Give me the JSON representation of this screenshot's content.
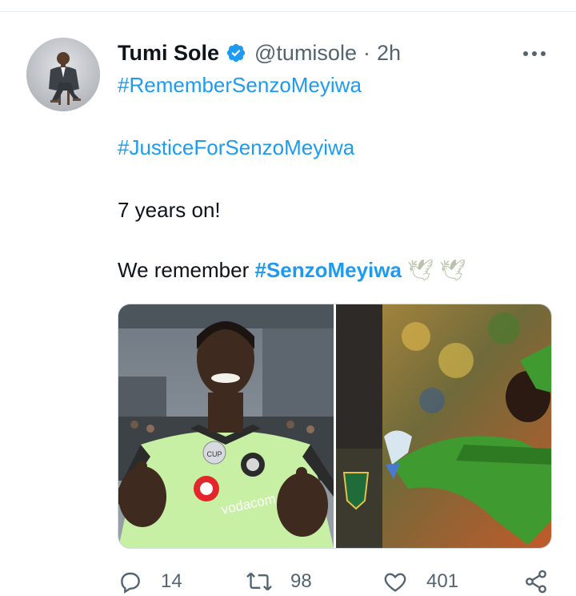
{
  "tweet": {
    "author_name": "Tumi Sole",
    "handle": "@tumisole",
    "separator": "·",
    "time": "2h",
    "lines": {
      "hashtag1": "#RememberSenzoMeyiwa",
      "hashtag2": "#JusticeForSenzoMeyiwa",
      "line3": "7 years on!",
      "line4_prefix": "We remember ",
      "line4_hashtag": "#SenzoMeyiwa",
      "line4_emoji": "🕊 🕊"
    }
  },
  "media": {
    "left_photo": {
      "badge_text": "CUP",
      "sponsor_text": "vodacom"
    }
  },
  "actions": {
    "replies": "14",
    "retweets": "98",
    "likes": "401"
  },
  "colors": {
    "accent": "#1d9bf0",
    "secondary_text": "#536471",
    "primary_text": "#0f1419",
    "divider": "#e6ecf0"
  },
  "icons": [
    "verified-icon",
    "more-icon",
    "reply-icon",
    "retweet-icon",
    "like-icon",
    "share-icon"
  ]
}
